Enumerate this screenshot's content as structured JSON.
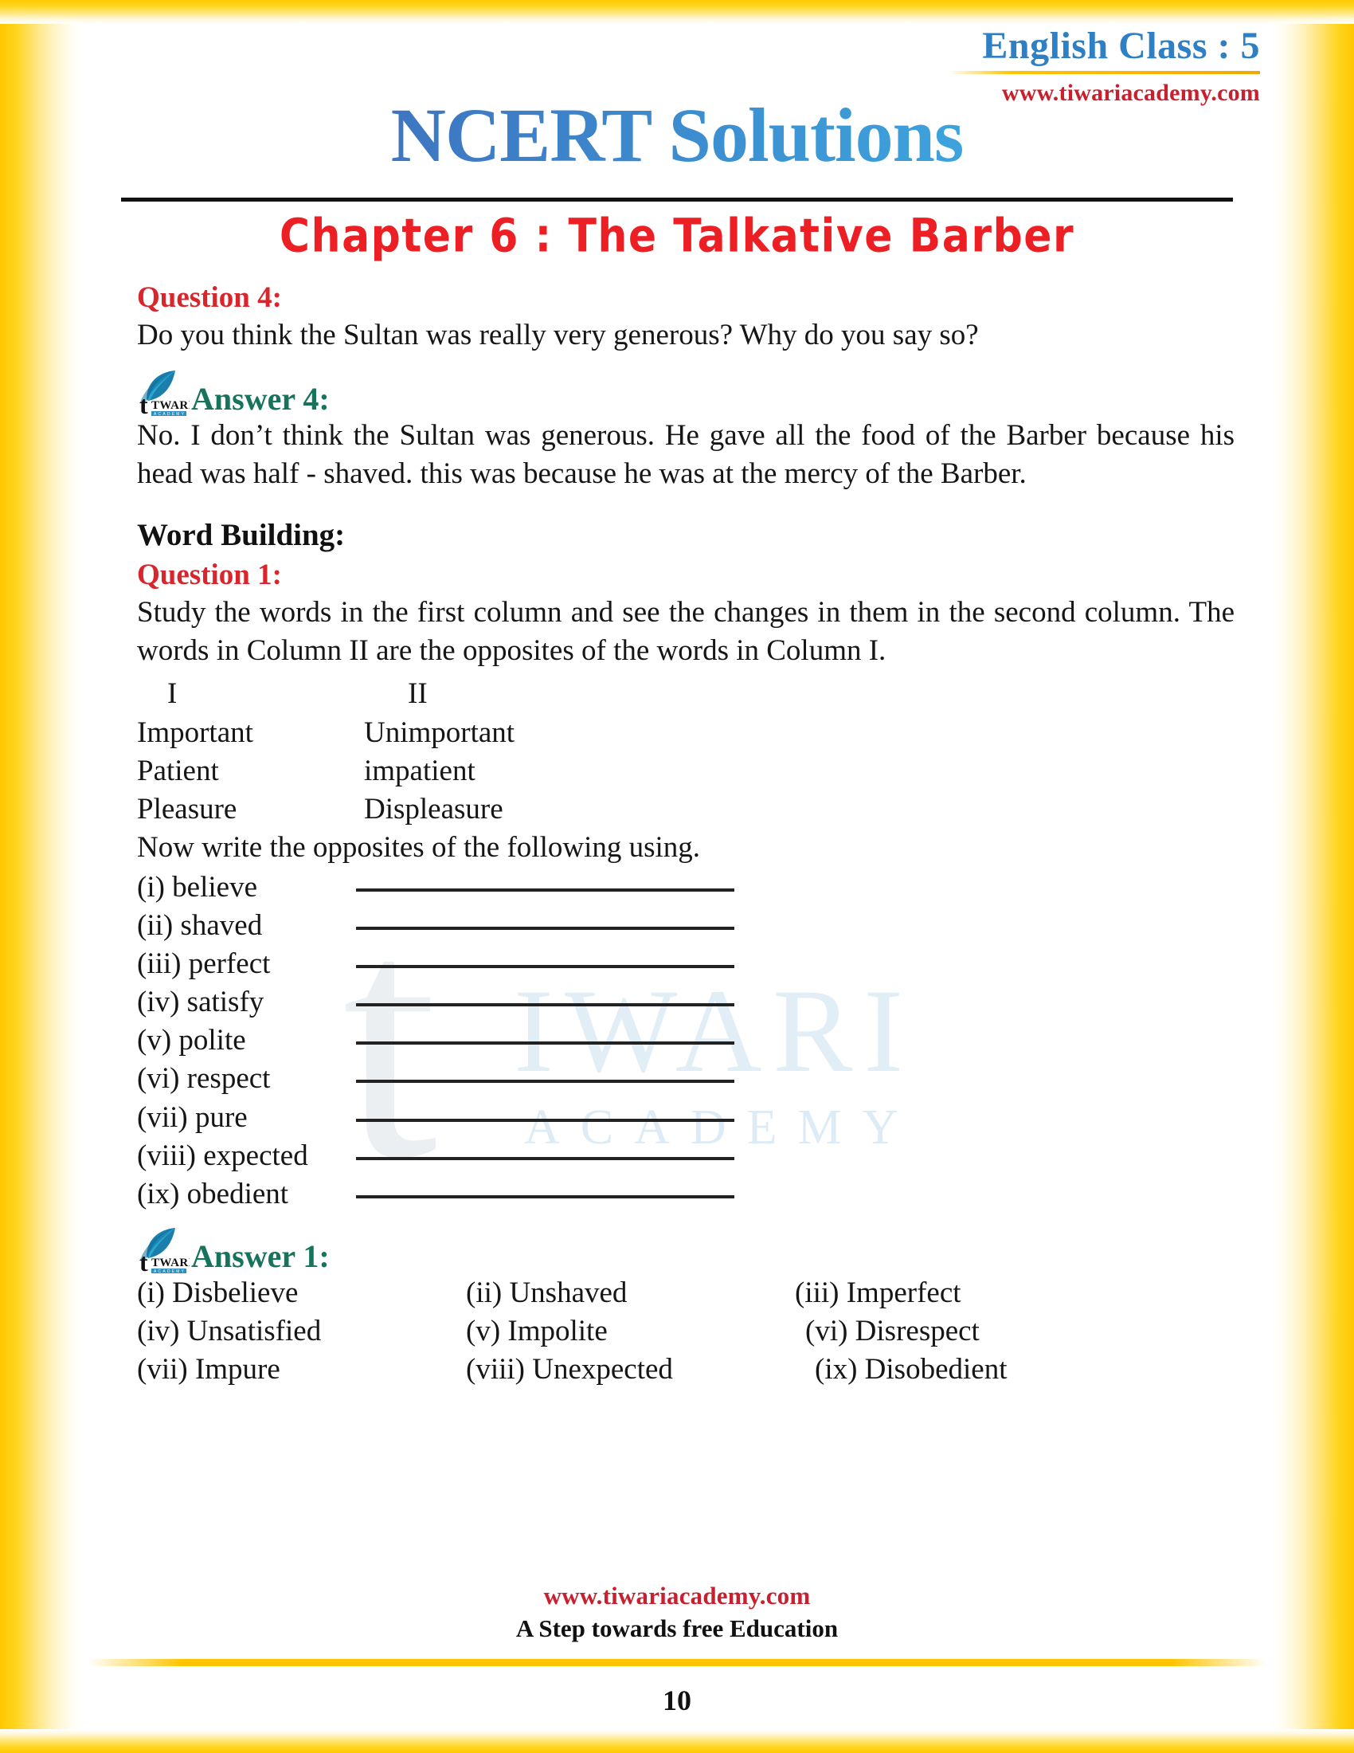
{
  "header": {
    "class_label": "English Class : 5",
    "site": "www.tiwariacademy.com",
    "brand": "NCERT Solutions",
    "chapter": "Chapter 6 : The Talkative Barber"
  },
  "q4": {
    "heading": "Question 4:",
    "text": "Do you think the Sultan was really very generous? Why do you say so?",
    "answer_label": "Answer 4:",
    "answer_text": "No. I don’t think the Sultan was generous. He gave all the food of the Barber because his head was half - shaved. this was because he was at the mercy of the Barber."
  },
  "word_building": {
    "section_title": "Word Building:",
    "heading": "Question 1:",
    "text": "Study the words in the first column and see the changes in them in the second column. The words in Column II are the opposites of the words in Column I.",
    "columns": [
      "I",
      "II"
    ],
    "pairs": [
      [
        "Important",
        "Unimportant"
      ],
      [
        "Patient",
        "impatient"
      ],
      [
        "Pleasure",
        "Displeasure"
      ]
    ],
    "instruction": "Now write the opposites of the following using.",
    "blanks": [
      "(i) believe",
      "(ii) shaved",
      "(iii) perfect",
      "(iv) satisfy",
      "(v) polite",
      "(vi) respect",
      "(vii) pure",
      "(viii) expected",
      "(ix) obedient"
    ],
    "answer_label": "Answer 1:",
    "answers": [
      [
        "(i) Disbelieve",
        "(ii) Unshaved",
        "(iii) Imperfect"
      ],
      [
        "(iv) Unsatisfied",
        "(v) Impolite",
        "(vi) Disrespect"
      ],
      [
        "(vii) Impure",
        "(viii) Unexpected",
        "(ix) Disobedient"
      ]
    ]
  },
  "footer": {
    "site": "www.tiwariacademy.com",
    "tagline": "A Step towards free Education",
    "page_number": "10"
  },
  "watermark": {
    "mark": "t",
    "word1": "IWARI",
    "word2": "ACADEMY"
  },
  "logo": {
    "letter": "t",
    "name": "TWARI",
    "sub": "ACADEMY"
  },
  "colors": {
    "brand_blue": "#3A5FAE",
    "accent_red": "#C8202E",
    "question_red": "#D8262C",
    "answer_green": "#17735C",
    "chapter_red": "#EC2024",
    "frame_yellow": "#FFC800"
  }
}
